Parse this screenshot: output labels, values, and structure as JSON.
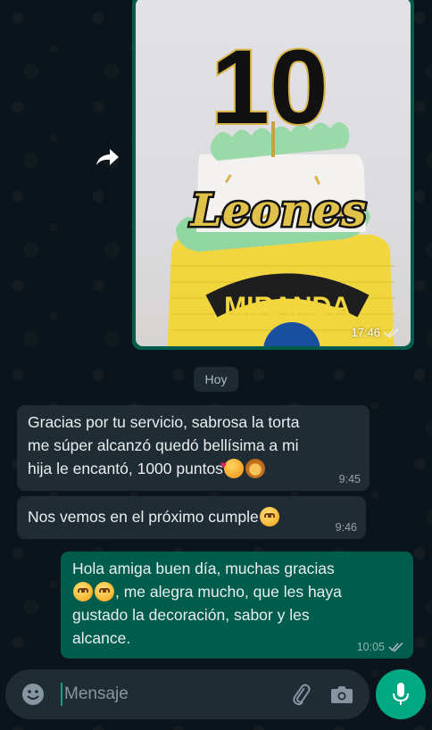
{
  "image_message": {
    "cake_number": "10",
    "cake_topper_text": "Leones",
    "cake_band_text": "MIRANDA",
    "time": "17:46",
    "status_icon": "double-check-icon"
  },
  "date_divider": "Hoy",
  "messages": [
    {
      "direction": "incoming",
      "line1": "Gracias por tu servicio, sabrosa la torta",
      "line2": "me súper alcanzó quedó bellísima a mi",
      "line3": "hija le encantó,  1000 puntos",
      "emojis": [
        "smiling-face-with-hearts",
        "lion-face"
      ],
      "time": "9:45"
    },
    {
      "direction": "incoming",
      "text": "Nos vemos en el próximo cumple",
      "emojis": [
        "hugging-face"
      ],
      "time": "9:46"
    },
    {
      "direction": "outgoing",
      "line1": "Hola amiga buen día, muchas gracias",
      "line2": ", me alegra mucho, que les haya",
      "line3": "gustado la decoración, sabor y les",
      "line4": "alcance.",
      "emojis": [
        "hugging-face",
        "hugging-face"
      ],
      "time": "10:05",
      "status_icon": "double-check-icon"
    }
  ],
  "composer": {
    "placeholder": "Mensaje",
    "emoji_icon": "smiley-icon",
    "attach_icon": "paperclip-icon",
    "camera_icon": "camera-icon",
    "mic_icon": "microphone-icon"
  },
  "colors": {
    "background": "#0b141a",
    "incoming_bubble": "#202c33",
    "outgoing_bubble": "#005c4b",
    "accent": "#00a884",
    "cake_green": "#8fd6a0",
    "cake_yellow": "#f2d640"
  }
}
